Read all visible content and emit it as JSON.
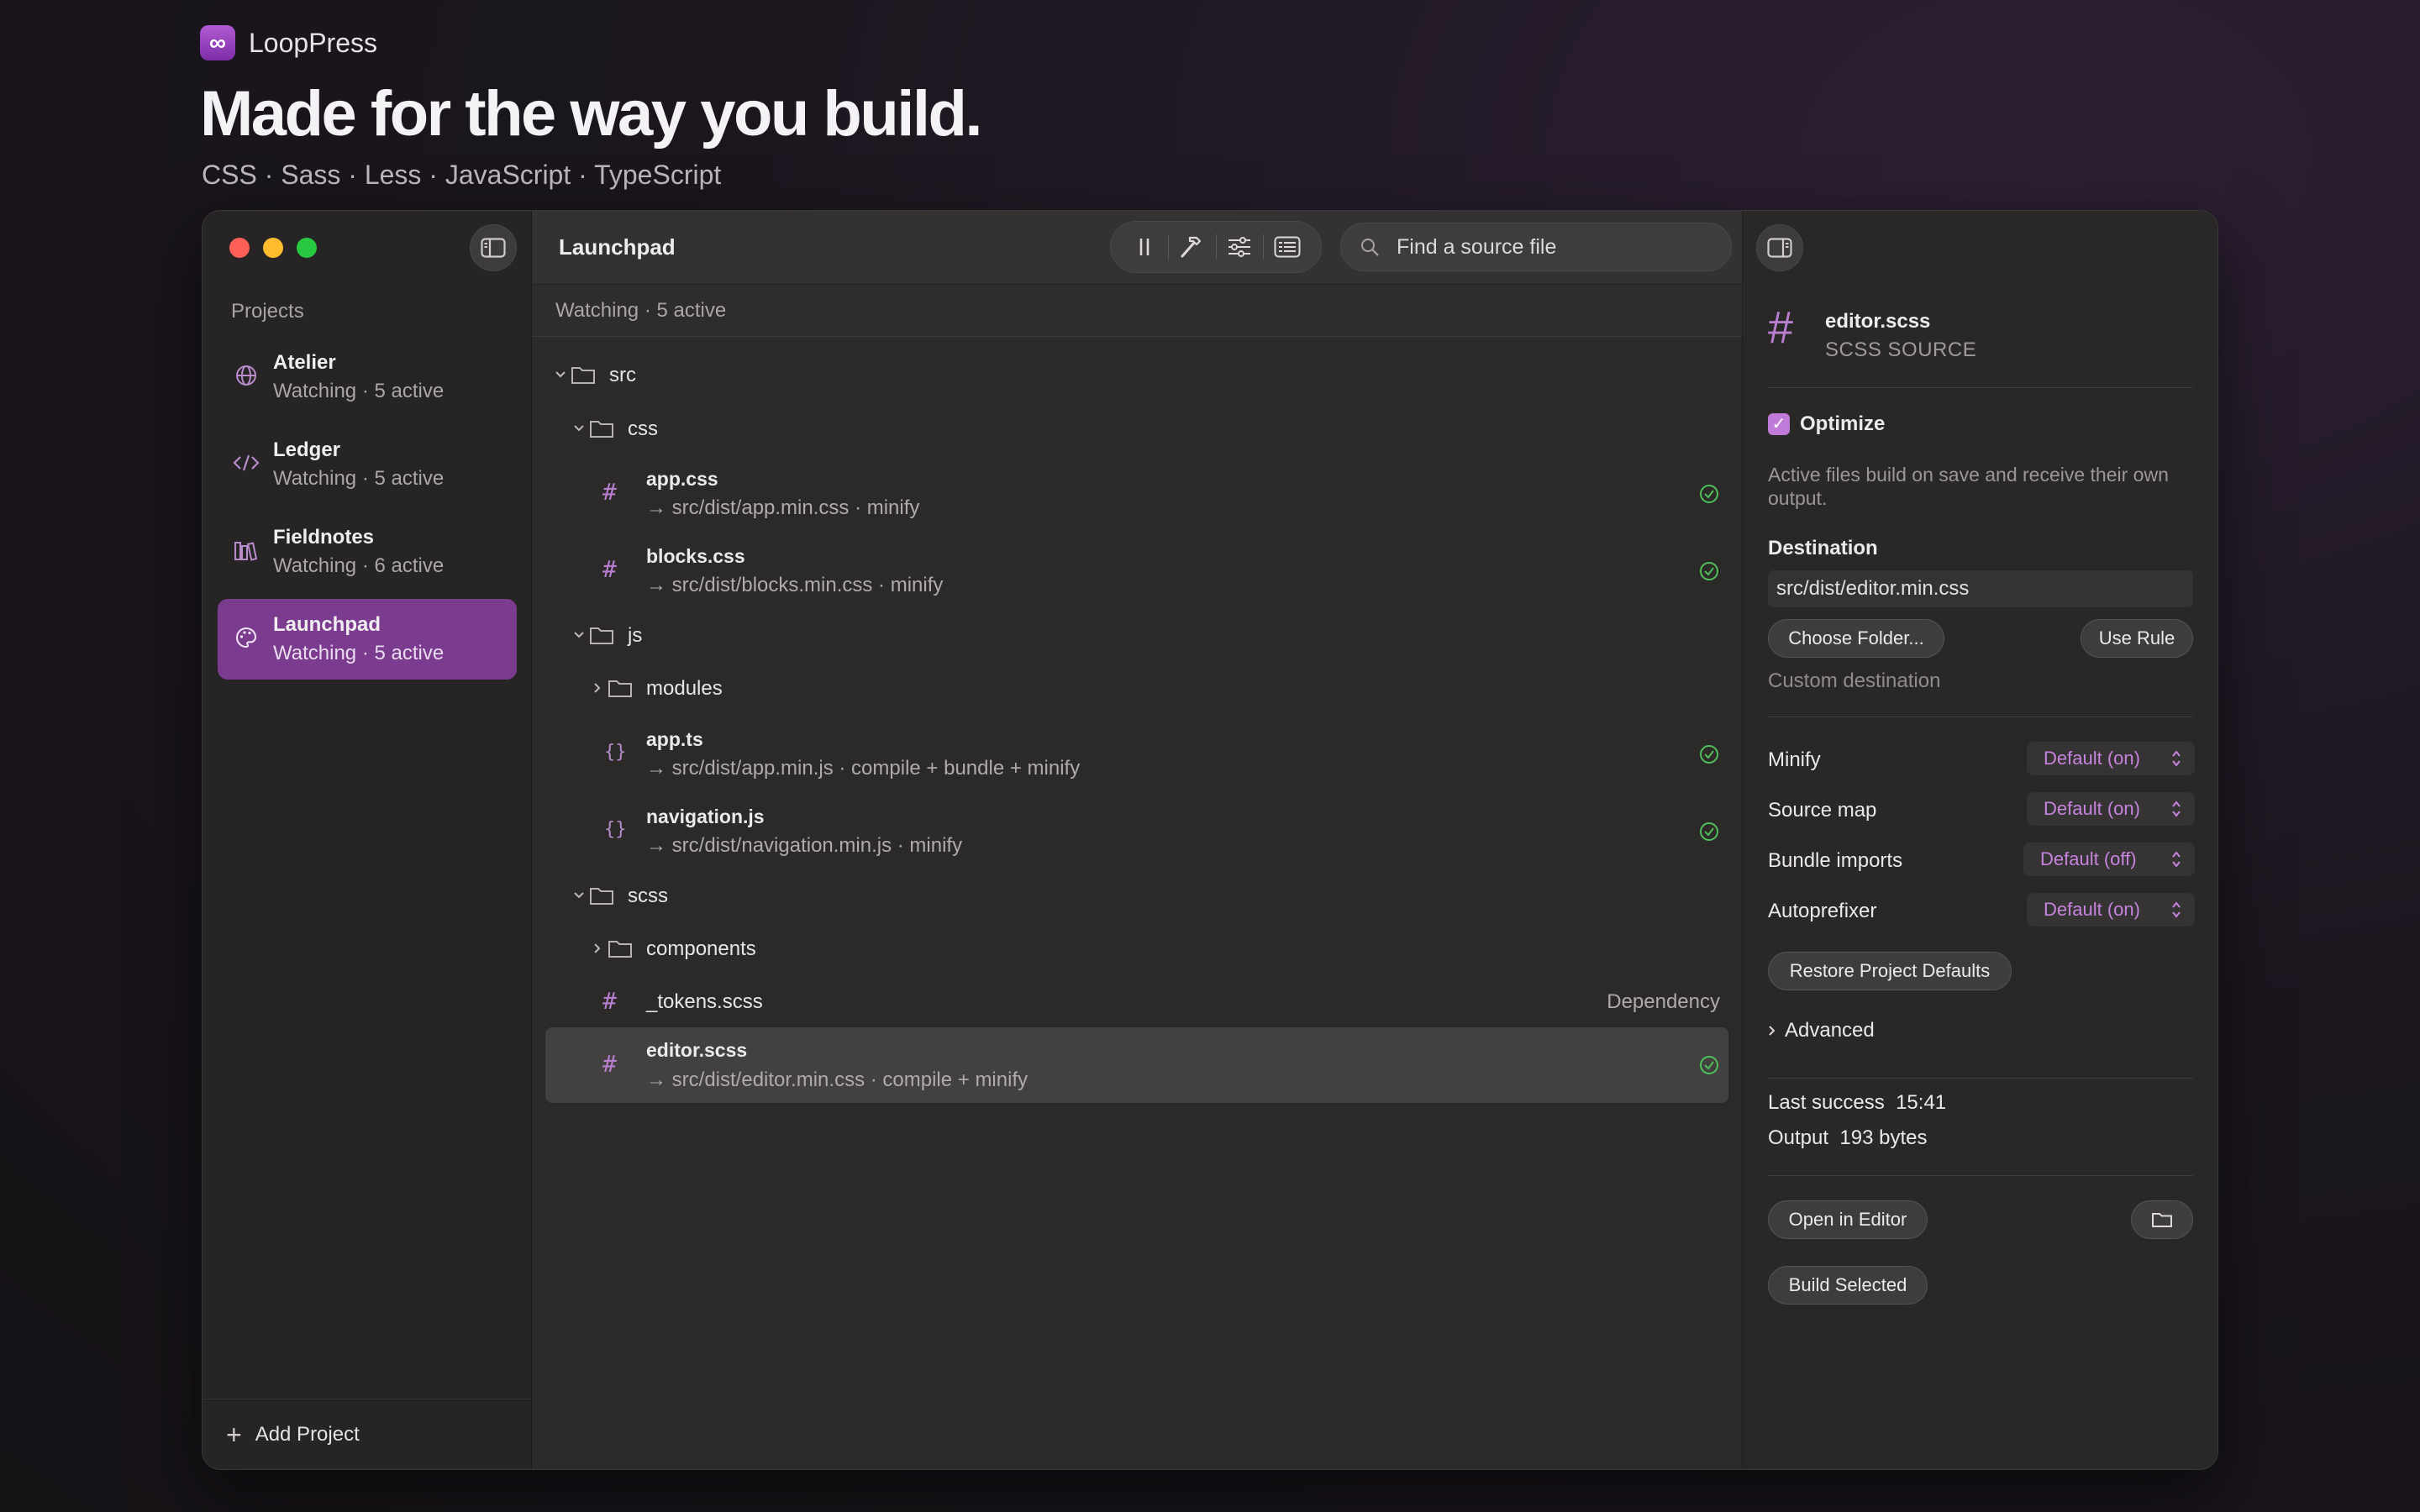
{
  "brand": {
    "logo_glyph": "∞",
    "name": "LoopPress"
  },
  "hero": {
    "title": "Made for the way you build.",
    "subtitle": "CSS · Sass · Less · JavaScript · TypeScript"
  },
  "colors": {
    "accent": "#7b3b8f",
    "accent_light": "#c07ad8",
    "success": "#4fbf5a"
  },
  "sidebar": {
    "section_label": "Projects",
    "projects": [
      {
        "name": "Atelier",
        "status": "Watching · 5 active",
        "icon": "globe-icon"
      },
      {
        "name": "Ledger",
        "status": "Watching · 5 active",
        "icon": "code-icon"
      },
      {
        "name": "Fieldnotes",
        "status": "Watching · 6 active",
        "icon": "books-icon"
      },
      {
        "name": "Launchpad",
        "status": "Watching · 5 active",
        "icon": "palette-icon",
        "active": true
      }
    ],
    "add_label": "Add Project"
  },
  "main": {
    "title": "Launchpad",
    "search_placeholder": "Find a source file",
    "status": "Watching · 5 active",
    "tree": {
      "src": "src",
      "css": "css",
      "app_css": {
        "name": "app.css",
        "output": "→ src/dist/app.min.css · minify"
      },
      "blocks_css": {
        "name": "blocks.css",
        "output": "→ src/dist/blocks.min.css · minify"
      },
      "js": "js",
      "modules": "modules",
      "app_ts": {
        "name": "app.ts",
        "output": "→ src/dist/app.min.js · compile + bundle + minify"
      },
      "navigation_js": {
        "name": "navigation.js",
        "output": "→ src/dist/navigation.min.js · minify"
      },
      "scss": "scss",
      "components": "components",
      "tokens_scss": {
        "name": "_tokens.scss",
        "badge": "Dependency"
      },
      "editor_scss": {
        "name": "editor.scss",
        "output": "→ src/dist/editor.min.css · compile + minify"
      }
    },
    "icon_glyphs": {
      "hash": "#",
      "braces": "{}"
    }
  },
  "inspector": {
    "file_name": "editor.scss",
    "file_type": "SCSS SOURCE",
    "optimize_label": "Optimize",
    "optimize_checked": true,
    "hint": "Active files build on save and receive their own output.",
    "destination_label": "Destination",
    "destination_value": "src/dist/editor.min.css",
    "choose_folder": "Choose Folder...",
    "use_rule": "Use Rule",
    "custom_destination": "Custom destination",
    "options": [
      {
        "label": "Minify",
        "value": "Default (on)"
      },
      {
        "label": "Source map",
        "value": "Default (on)"
      },
      {
        "label": "Bundle imports",
        "value": "Default (off)"
      },
      {
        "label": "Autoprefixer",
        "value": "Default (on)"
      }
    ],
    "restore_defaults": "Restore Project Defaults",
    "advanced": "Advanced",
    "last_success_label": "Last success",
    "last_success_value": "15:41",
    "output_label": "Output",
    "output_value": "193 bytes",
    "open_in_editor": "Open in Editor",
    "build_selected": "Build Selected"
  }
}
